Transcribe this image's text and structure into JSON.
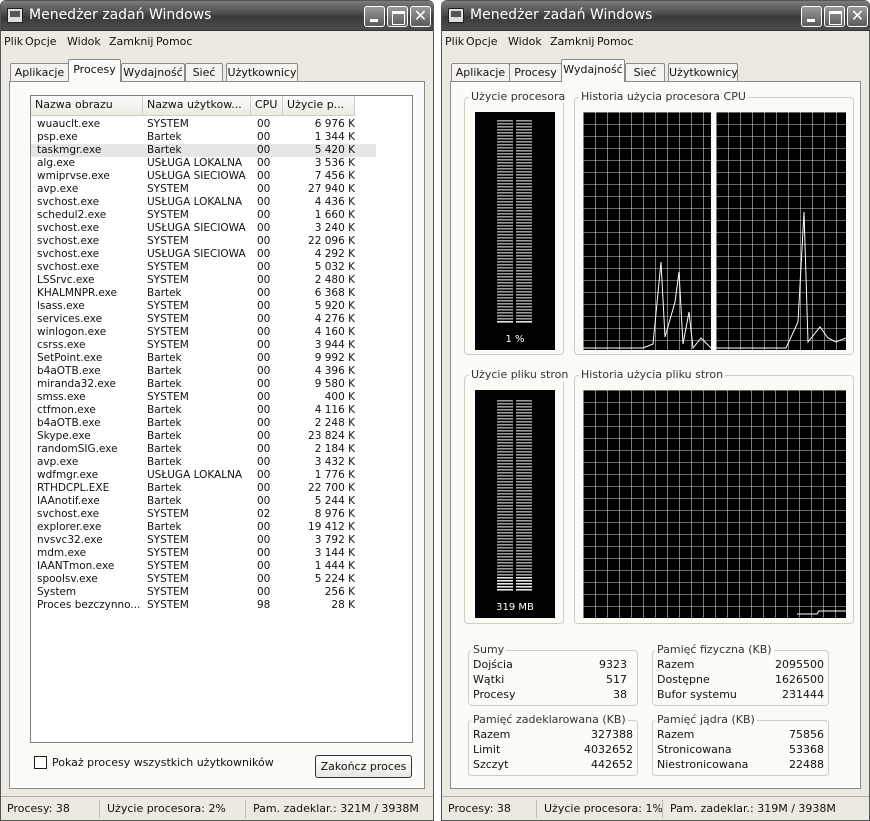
{
  "window_title": "Menedżer zadań Windows",
  "menu": [
    "Plik",
    "Opcje",
    "Widok",
    "Zamknij",
    "Pomoc"
  ],
  "tabs": [
    "Aplikacje",
    "Procesy",
    "Wydajność",
    "Sieć",
    "Użytkownicy"
  ],
  "left": {
    "active_tab": "Procesy",
    "columns": [
      "Nazwa obrazu",
      "Nazwa użytkow...",
      "CPU",
      "Użycie p..."
    ],
    "rows": [
      [
        "wuauclt.exe",
        "SYSTEM",
        "00",
        "6 976 K"
      ],
      [
        "psp.exe",
        "Bartek",
        "00",
        "1 344 K"
      ],
      [
        "taskmgr.exe",
        "Bartek",
        "00",
        "5 420 K"
      ],
      [
        "alg.exe",
        "USŁUGA LOKALNA",
        "00",
        "3 536 K"
      ],
      [
        "wmiprvse.exe",
        "USŁUGA SIECIOWA",
        "00",
        "7 456 K"
      ],
      [
        "avp.exe",
        "SYSTEM",
        "00",
        "27 940 K"
      ],
      [
        "svchost.exe",
        "USŁUGA LOKALNA",
        "00",
        "4 436 K"
      ],
      [
        "schedul2.exe",
        "SYSTEM",
        "00",
        "1 660 K"
      ],
      [
        "svchost.exe",
        "USŁUGA SIECIOWA",
        "00",
        "3 240 K"
      ],
      [
        "svchost.exe",
        "SYSTEM",
        "00",
        "22 096 K"
      ],
      [
        "svchost.exe",
        "USŁUGA SIECIOWA",
        "00",
        "4 292 K"
      ],
      [
        "svchost.exe",
        "SYSTEM",
        "00",
        "5 032 K"
      ],
      [
        "LSSrvc.exe",
        "SYSTEM",
        "00",
        "2 480 K"
      ],
      [
        "KHALMNPR.exe",
        "Bartek",
        "00",
        "6 368 K"
      ],
      [
        "lsass.exe",
        "SYSTEM",
        "00",
        "5 920 K"
      ],
      [
        "services.exe",
        "SYSTEM",
        "00",
        "4 276 K"
      ],
      [
        "winlogon.exe",
        "SYSTEM",
        "00",
        "4 160 K"
      ],
      [
        "csrss.exe",
        "SYSTEM",
        "00",
        "3 944 K"
      ],
      [
        "SetPoint.exe",
        "Bartek",
        "00",
        "9 992 K"
      ],
      [
        "b4aOTB.exe",
        "Bartek",
        "00",
        "4 396 K"
      ],
      [
        "miranda32.exe",
        "Bartek",
        "00",
        "9 580 K"
      ],
      [
        "smss.exe",
        "SYSTEM",
        "00",
        "400 K"
      ],
      [
        "ctfmon.exe",
        "Bartek",
        "00",
        "4 116 K"
      ],
      [
        "b4aOTB.exe",
        "Bartek",
        "00",
        "2 248 K"
      ],
      [
        "Skype.exe",
        "Bartek",
        "00",
        "23 824 K"
      ],
      [
        "randomSIG.exe",
        "Bartek",
        "00",
        "2 184 K"
      ],
      [
        "avp.exe",
        "Bartek",
        "00",
        "3 432 K"
      ],
      [
        "wdfmgr.exe",
        "USŁUGA LOKALNA",
        "00",
        "1 776 K"
      ],
      [
        "RTHDCPL.EXE",
        "Bartek",
        "00",
        "22 700 K"
      ],
      [
        "IAAnotif.exe",
        "Bartek",
        "00",
        "5 244 K"
      ],
      [
        "svchost.exe",
        "SYSTEM",
        "02",
        "8 976 K"
      ],
      [
        "explorer.exe",
        "Bartek",
        "00",
        "19 412 K"
      ],
      [
        "nvsvc32.exe",
        "SYSTEM",
        "00",
        "3 792 K"
      ],
      [
        "mdm.exe",
        "SYSTEM",
        "00",
        "3 144 K"
      ],
      [
        "IAANTmon.exe",
        "SYSTEM",
        "00",
        "1 444 K"
      ],
      [
        "spoolsv.exe",
        "SYSTEM",
        "00",
        "5 224 K"
      ],
      [
        "System",
        "SYSTEM",
        "00",
        "256 K"
      ],
      [
        "Proces bezczynno...",
        "SYSTEM",
        "98",
        "28 K"
      ]
    ],
    "selected_row": 2,
    "show_all_checkbox": "Pokaż procesy wszystkich użytkowników",
    "end_process_button": "Zakończ proces",
    "status": [
      "Procesy: 38",
      "Użycie procesora: 2%",
      "Pam. zadeklar.: 321M / 3938M"
    ]
  },
  "right": {
    "active_tab": "Wydajność",
    "cpu_usage_label": "Użycie procesora",
    "cpu_usage_value": "1 %",
    "cpu_usage_fraction": 0.01,
    "cpu_history_label": "Historia użycia procesora CPU",
    "page_usage_label": "Użycie pliku stron",
    "page_usage_value": "319 MB",
    "page_usage_fraction": 0.08,
    "page_history_label": "Historia użycia pliku stron",
    "totals": {
      "label": "Sumy",
      "items": [
        [
          "Dojścia",
          "9323"
        ],
        [
          "Wątki",
          "517"
        ],
        [
          "Procesy",
          "38"
        ]
      ]
    },
    "physical": {
      "label": "Pamięć fizyczna (KB)",
      "items": [
        [
          "Razem",
          "2095500"
        ],
        [
          "Dostępne",
          "1626500"
        ],
        [
          "Bufor systemu",
          "231444"
        ]
      ]
    },
    "commit": {
      "label": "Pamięć zadeklarowana (KB)",
      "items": [
        [
          "Razem",
          "327388"
        ],
        [
          "Limit",
          "4032652"
        ],
        [
          "Szczyt",
          "442652"
        ]
      ]
    },
    "kernel": {
      "label": "Pamięć jądra (KB)",
      "items": [
        [
          "Razem",
          "75856"
        ],
        [
          "Stronicowana",
          "53368"
        ],
        [
          "Niestronicowana",
          "22488"
        ]
      ]
    },
    "status": [
      "Procesy: 38",
      "Użycie procesora: 1%",
      "Pam. zadeklar.: 319M / 3938M"
    ]
  },
  "colors": {
    "graph_bg": "#000000",
    "grid": "#cfcfcf",
    "meter": "#e6e6e6",
    "line": "#ffffff"
  }
}
